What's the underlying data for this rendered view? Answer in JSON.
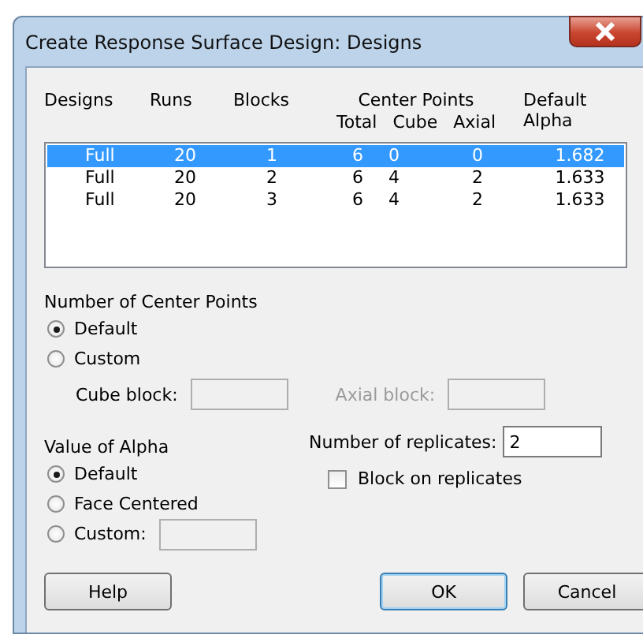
{
  "window": {
    "title": "Create Response Surface Design: Designs"
  },
  "table": {
    "headers": {
      "designs": "Designs",
      "runs": "Runs",
      "blocks": "Blocks",
      "center_points": "Center Points",
      "total": "Total",
      "cube": "Cube",
      "axial": "Axial",
      "alpha": "Default Alpha"
    },
    "rows": [
      {
        "selected": true,
        "cells": [
          "Full",
          "20",
          "1",
          "6",
          "0",
          "0",
          "1.682"
        ]
      },
      {
        "selected": false,
        "cells": [
          "Full",
          "20",
          "2",
          "6",
          "4",
          "2",
          "1.633"
        ]
      },
      {
        "selected": false,
        "cells": [
          "Full",
          "20",
          "3",
          "6",
          "4",
          "2",
          "1.633"
        ]
      }
    ]
  },
  "center_points": {
    "label": "Number of Center Points",
    "options": [
      {
        "label": "Default",
        "selected": true
      },
      {
        "label": "Custom",
        "selected": false
      }
    ],
    "cube_block": {
      "label": "Cube block:",
      "disabled": false
    },
    "axial_block": {
      "label": "Axial block:",
      "disabled": true
    }
  },
  "alpha": {
    "label": "Value of Alpha",
    "options": [
      {
        "label": "Default",
        "selected": true
      },
      {
        "label": "Face Centered",
        "selected": false
      },
      {
        "label": "Custom:",
        "selected": false
      }
    ]
  },
  "replicates": {
    "label": "Number of replicates:",
    "value": "2"
  },
  "block_on_replicates": {
    "label": "Block on replicates",
    "checked": false
  },
  "buttons": {
    "help": "Help",
    "ok": "OK",
    "cancel": "Cancel"
  }
}
